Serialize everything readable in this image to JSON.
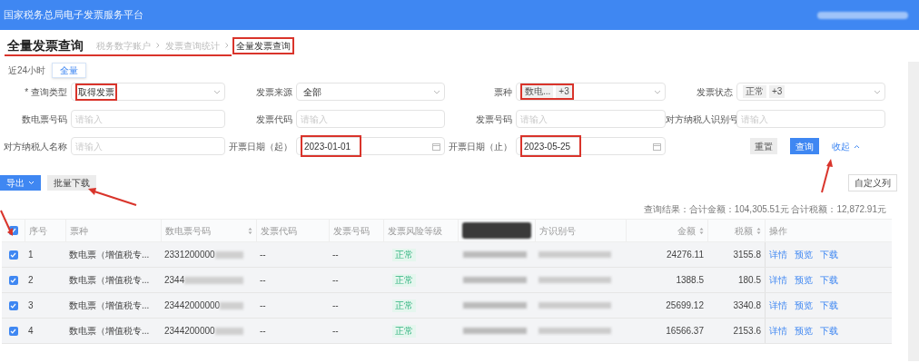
{
  "header": {
    "title": "国家税务总局电子发票服务平台"
  },
  "page": {
    "title": "全量发票查询",
    "breadcrumb": [
      {
        "label": "税务数字账户",
        "current": false,
        "highlighted": false
      },
      {
        "label": "发票查询统计",
        "current": false,
        "highlighted": false
      },
      {
        "label": "全量发票查询",
        "current": true,
        "highlighted": true
      }
    ]
  },
  "tabs": [
    {
      "label": "近24小时",
      "selected": false
    },
    {
      "label": "全量",
      "selected": true
    }
  ],
  "form": {
    "fields": [
      {
        "kind": "select",
        "label": "* 查询类型",
        "value": "取得发票",
        "highlighted": true
      },
      {
        "kind": "select",
        "label": "发票来源",
        "value": "全部",
        "highlighted": false
      },
      {
        "kind": "tags",
        "label": "票种",
        "tags": [
          "数电...",
          "+3"
        ],
        "highlighted": true
      },
      {
        "kind": "tags",
        "label": "发票状态",
        "tags": [
          "正常",
          "+3"
        ],
        "highlighted": false
      },
      {
        "kind": "input",
        "label": "数电票号码",
        "placeholder": "请输入",
        "highlighted": false
      },
      {
        "kind": "input",
        "label": "发票代码",
        "placeholder": "请输入",
        "highlighted": false
      },
      {
        "kind": "input",
        "label": "发票号码",
        "placeholder": "请输入",
        "highlighted": false
      },
      {
        "kind": "input",
        "label": "对方纳税人识别号",
        "placeholder": "请输入",
        "highlighted": false
      },
      {
        "kind": "input",
        "label": "对方纳税人名称",
        "placeholder": "请输入",
        "highlighted": false
      },
      {
        "kind": "date",
        "label": "开票日期（起）",
        "value": "2023-01-01",
        "highlighted": true
      },
      {
        "kind": "date",
        "label": "开票日期（止）",
        "value": "2023-05-25",
        "highlighted": true
      }
    ],
    "reset_button": "重置",
    "query_button": "查询",
    "collapse_link": "收起"
  },
  "toolbar": {
    "export_button": "导出",
    "batch_download_button": "批量下载",
    "custom_columns_button": "自定义列"
  },
  "summary": "查询结果：合计金额：104,305.51元  合计税额：12,872.91元",
  "table": {
    "all_checked": true,
    "columns": [
      {
        "label": "序号",
        "sortable": false
      },
      {
        "label": "票种",
        "sortable": false
      },
      {
        "label": "数电票号码",
        "sortable": true
      },
      {
        "label": "发票代码",
        "sortable": false
      },
      {
        "label": "发票号码",
        "sortable": false
      },
      {
        "label": "发票风险等级",
        "sortable": false
      },
      {
        "sortable": false,
        "covered": true
      },
      {
        "label": "方识别号",
        "sortable": false
      },
      {
        "label": "金额",
        "sortable": true
      },
      {
        "label": "税额",
        "sortable": true
      },
      {
        "label": "操作",
        "sortable": false
      }
    ],
    "rows": [
      {
        "checked": true,
        "index": "1",
        "type": "数电票（增值税专...",
        "number": "2331200000",
        "code": "--",
        "invoice_no": "--",
        "risk": "正常",
        "amount": "24276.11",
        "tax": "3155.8",
        "actions": [
          "详情",
          "预览",
          "下载"
        ]
      },
      {
        "checked": true,
        "index": "2",
        "type": "数电票（增值税专...",
        "number": "2344",
        "code": "--",
        "invoice_no": "--",
        "risk": "正常",
        "amount": "1388.5",
        "tax": "180.5",
        "actions": [
          "详情",
          "预览",
          "下载"
        ]
      },
      {
        "checked": true,
        "index": "3",
        "type": "数电票（增值税专...",
        "number": "23442000000",
        "code": "--",
        "invoice_no": "--",
        "risk": "正常",
        "amount": "25699.12",
        "tax": "3340.8",
        "actions": [
          "详情",
          "预览",
          "下载"
        ]
      },
      {
        "checked": true,
        "index": "4",
        "type": "数电票（增值税专...",
        "number": "2344200000",
        "code": "--",
        "invoice_no": "--",
        "risk": "正常",
        "amount": "16566.37",
        "tax": "2153.6",
        "actions": [
          "详情",
          "预览",
          "下载"
        ]
      }
    ]
  }
}
